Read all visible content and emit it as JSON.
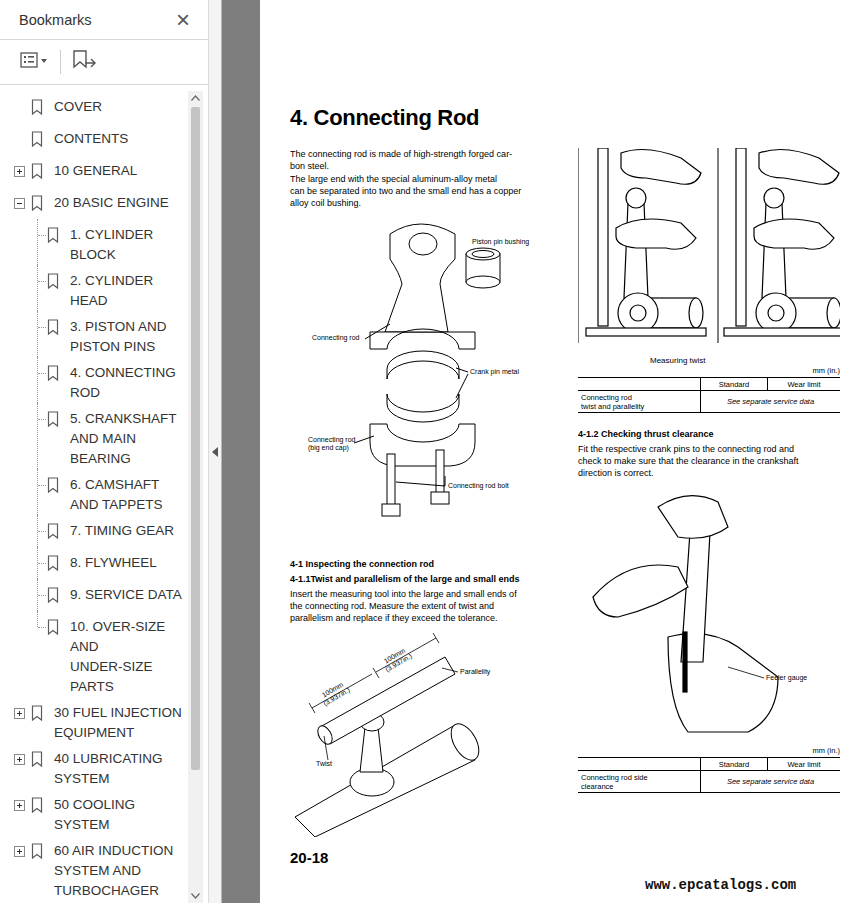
{
  "bookmarks": {
    "title": "Bookmarks",
    "close": "×",
    "scrollbar": {
      "level": 0.85
    },
    "items": [
      {
        "lines": [
          "COVER"
        ],
        "kind": "top",
        "expandable": false,
        "expanded": false
      },
      {
        "lines": [
          "CONTENTS"
        ],
        "kind": "top",
        "expandable": false,
        "expanded": false
      },
      {
        "lines": [
          "10 GENERAL"
        ],
        "kind": "top",
        "expandable": true,
        "expanded": false
      },
      {
        "lines": [
          "20 BASIC ENGINE"
        ],
        "kind": "top",
        "expandable": true,
        "expanded": true
      },
      {
        "lines": [
          "1. CYLINDER",
          "BLOCK"
        ],
        "kind": "child",
        "expandable": false,
        "expanded": false
      },
      {
        "lines": [
          "2. CYLINDER",
          "HEAD"
        ],
        "kind": "child",
        "expandable": false,
        "expanded": false
      },
      {
        "lines": [
          "3. PISTON AND",
          "PISTON PINS"
        ],
        "kind": "child",
        "expandable": false,
        "expanded": false
      },
      {
        "lines": [
          "4. CONNECTING",
          "ROD"
        ],
        "kind": "child",
        "expandable": false,
        "expanded": false
      },
      {
        "lines": [
          "5. CRANKSHAFT",
          "AND MAIN",
          "BEARING"
        ],
        "kind": "child",
        "expandable": false,
        "expanded": false
      },
      {
        "lines": [
          "6. CAMSHAFT",
          "AND TAPPETS"
        ],
        "kind": "child",
        "expandable": false,
        "expanded": false
      },
      {
        "lines": [
          "7. TIMING GEAR"
        ],
        "kind": "child",
        "expandable": false,
        "expanded": false
      },
      {
        "lines": [
          "8. FLYWHEEL"
        ],
        "kind": "child",
        "expandable": false,
        "expanded": false
      },
      {
        "lines": [
          "9. SERVICE DATA"
        ],
        "kind": "child",
        "expandable": false,
        "expanded": false
      },
      {
        "lines": [
          "10. OVER-SIZE",
          "AND",
          "UNDER-SIZE",
          "PARTS"
        ],
        "kind": "child",
        "expandable": false,
        "expanded": false
      },
      {
        "lines": [
          "30 FUEL INJECTION",
          "EQUIPMENT"
        ],
        "kind": "top",
        "expandable": true,
        "expanded": false
      },
      {
        "lines": [
          "40 LUBRICATING",
          "SYSTEM"
        ],
        "kind": "top",
        "expandable": true,
        "expanded": false
      },
      {
        "lines": [
          "50 COOLING",
          "SYSTEM"
        ],
        "kind": "top",
        "expandable": true,
        "expanded": false
      },
      {
        "lines": [
          "60 AIR INDUCTION",
          "SYSTEM AND",
          "TURBOCHAGER"
        ],
        "kind": "top",
        "expandable": true,
        "expanded": false
      }
    ]
  },
  "document": {
    "title": "4. Connecting Rod",
    "intro": [
      "The connecting rod is made of high-strength forged car-",
      "bon steel.",
      "The large end with the special aluminum-alloy metal",
      "can be separated into two and the small end has a copper",
      "alloy coil bushing."
    ],
    "exploded_figure": {
      "labels": [
        {
          "lines": [
            "Piston pin bushing"
          ]
        },
        {
          "lines": [
            "Connecting rod"
          ]
        },
        {
          "lines": [
            "Crank pin metal"
          ]
        },
        {
          "lines": [
            "Connecting rod",
            "(big end cap)"
          ]
        },
        {
          "lines": [
            "Connecting rod bolt"
          ]
        }
      ]
    },
    "section_heading": "4-1 Inspecting the connection rod",
    "twist_section": {
      "heading": "4-1.1Twist and parallelism of the large and small ends",
      "body": [
        "Insert the measuring tool into the large and small ends of",
        "the connecting rod. Measure the extent of twist and",
        "parallelism and replace if they exceed the tolerance."
      ],
      "figure": {
        "labels": [
          {
            "lines": [
              "100mm",
              "(3.937in.)"
            ]
          },
          {
            "lines": [
              "100mm",
              "(3.937in.)"
            ]
          },
          {
            "lines": [
              "Parallelity"
            ]
          },
          {
            "lines": [
              "Twist"
            ]
          }
        ]
      }
    },
    "twist_photo": {
      "caption": "Measuring twist"
    },
    "twist_table": {
      "unit": "mm (in.)",
      "columns": [
        "Standard",
        "Wear limit"
      ],
      "row": {
        "label": [
          "Connecting rod",
          "twist and parallelity"
        ],
        "value": "See separate service data"
      }
    },
    "thrust_section": {
      "heading": "4-1.2 Checking thrust clearance",
      "body": [
        "Fit the respective crank pins to the connecting rod and",
        "check to make sure that the clearance in the crankshaft",
        "direction is correct."
      ],
      "figure": {
        "labels": [
          {
            "lines": [
              "Feeler gauge"
            ]
          }
        ]
      }
    },
    "thrust_table": {
      "unit": "mm (in.)",
      "columns": [
        "Standard",
        "Wear limit"
      ],
      "row": {
        "label": [
          "Connecting rod side",
          "clearance"
        ],
        "value": "See separate service data"
      }
    },
    "page_number": "20-18",
    "watermark": "www.epcatalogs.com"
  }
}
